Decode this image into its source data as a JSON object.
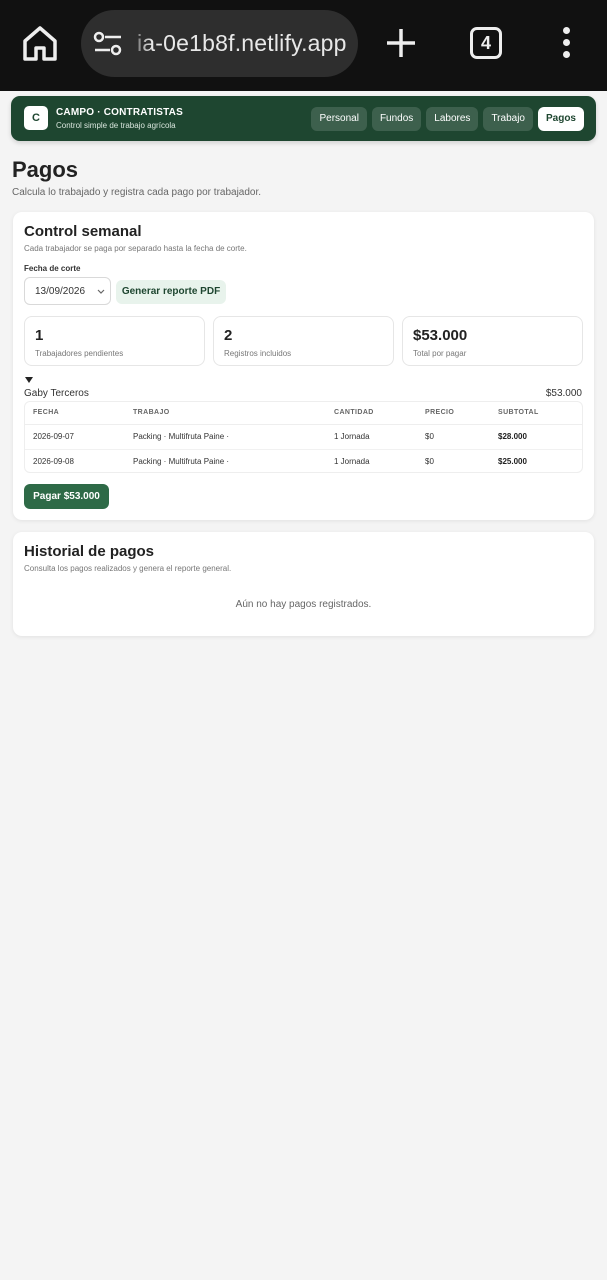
{
  "browser": {
    "url": "ia-0e1b8f.netlify.app",
    "tab_count": "4"
  },
  "header": {
    "logo_letter": "C",
    "brand_title": "CAMPO · CONTRATISTAS",
    "brand_subtitle": "Control simple de trabajo agrícola",
    "nav": [
      {
        "label": "Personal",
        "active": false
      },
      {
        "label": "Fundos",
        "active": false
      },
      {
        "label": "Labores",
        "active": false
      },
      {
        "label": "Trabajo",
        "active": false
      },
      {
        "label": "Pagos",
        "active": true
      }
    ]
  },
  "page": {
    "title": "Pagos",
    "subtitle": "Calcula lo trabajado y registra cada pago por trabajador."
  },
  "weekly": {
    "title": "Control semanal",
    "subtitle": "Cada trabajador se paga por separado hasta la fecha de corte.",
    "cutoff_label": "Fecha de corte",
    "cutoff_value": "13/09/2026",
    "pdf_button": "Generar reporte PDF",
    "stats": [
      {
        "value": "1",
        "label": "Trabajadores pendientes"
      },
      {
        "value": "2",
        "label": "Registros incluidos"
      },
      {
        "value": "$53.000",
        "label": "Total por pagar"
      }
    ],
    "worker": {
      "name": "Gaby Terceros",
      "total": "$53.000",
      "columns": [
        "FECHA",
        "TRABAJO",
        "CANTIDAD",
        "PRECIO",
        "SUBTOTAL"
      ],
      "rows": [
        [
          "2026-09-07",
          "Packing · Multifruta Paine ·",
          "1 Jornada",
          "$0",
          "$28.000"
        ],
        [
          "2026-09-08",
          "Packing · Multifruta Paine ·",
          "1 Jornada",
          "$0",
          "$25.000"
        ]
      ]
    },
    "pay_button": "Pagar $53.000"
  },
  "history": {
    "title": "Historial de pagos",
    "subtitle": "Consulta los pagos realizados y genera el reporte general.",
    "empty": "Aún no hay pagos registrados."
  }
}
